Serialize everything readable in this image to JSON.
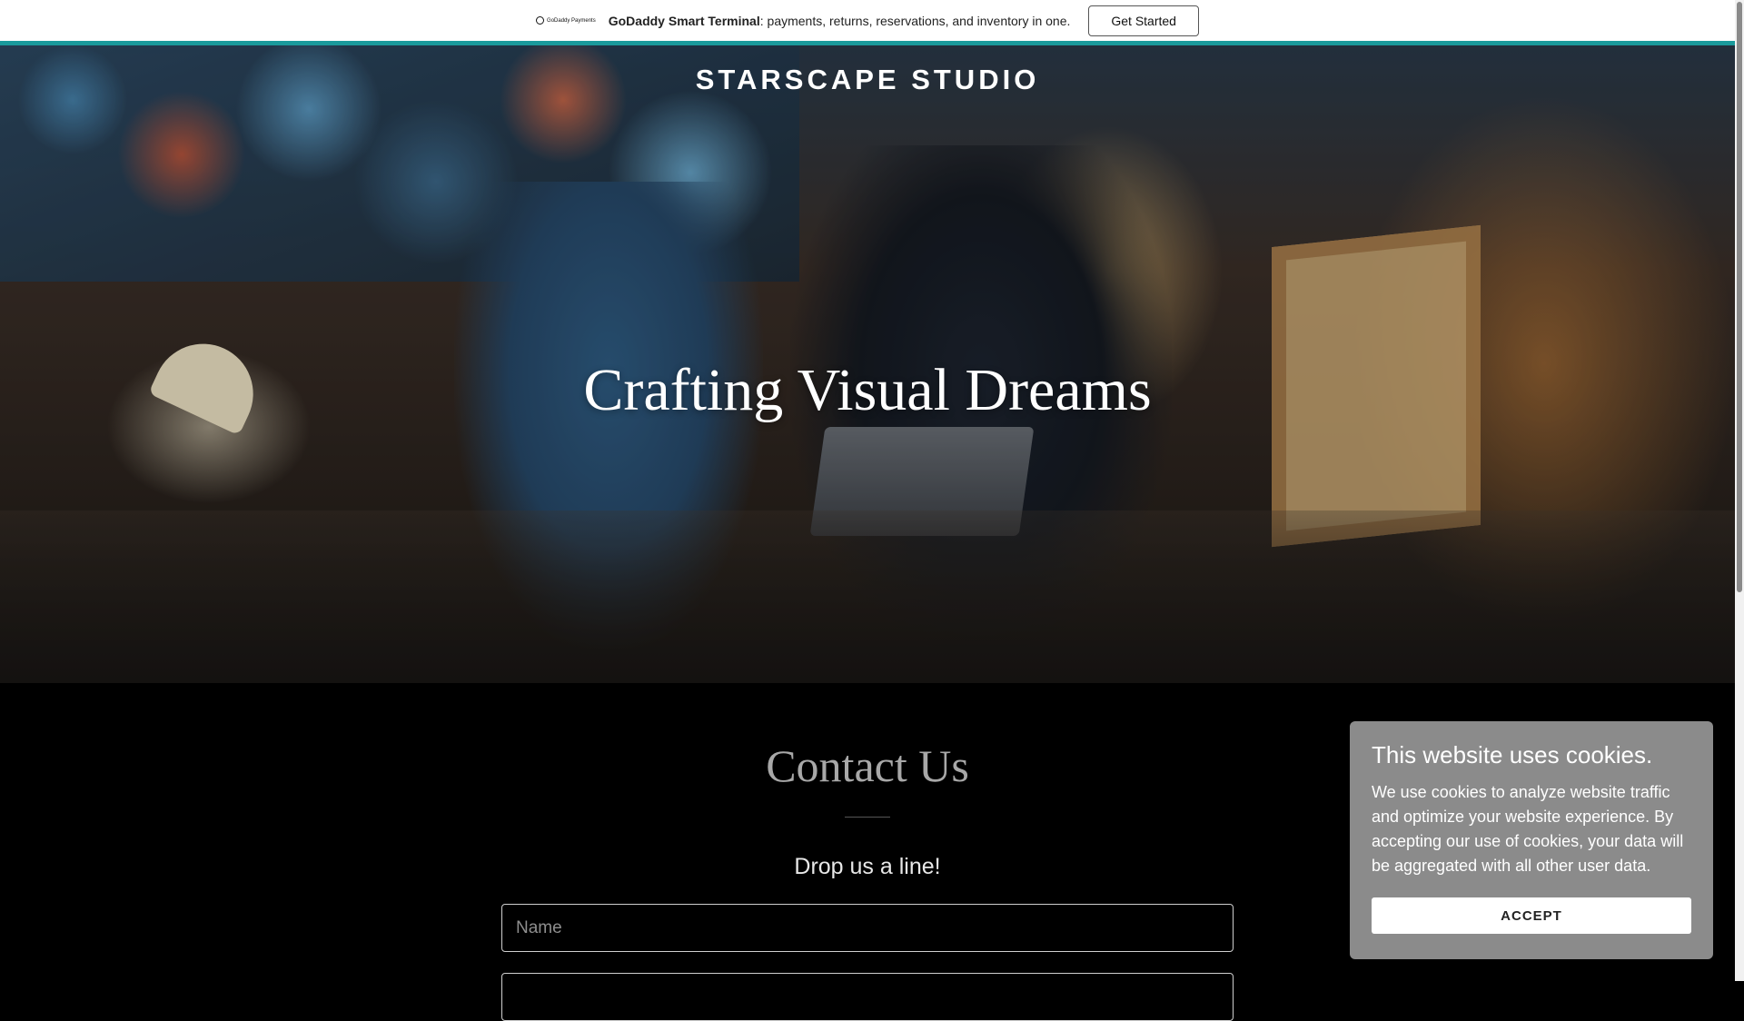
{
  "promo": {
    "logo_text": "GoDaddy Payments",
    "headline_bold": "GoDaddy Smart Terminal",
    "headline_rest": ": payments, returns, reservations, and inventory in one.",
    "cta_label": "Get Started",
    "accent_color": "#1a9a9c"
  },
  "hero": {
    "site_title": "STARSCAPE STUDIO",
    "headline": "Crafting Visual Dreams"
  },
  "contact": {
    "title": "Contact Us",
    "subtitle": "Drop us a line!",
    "name_placeholder": "Name",
    "email_placeholder": ""
  },
  "cookie_banner": {
    "title": "This website uses cookies.",
    "body": "We use cookies to analyze website traffic and optimize your website experience. By accepting our use of cookies, your data will be aggregated with all other user data.",
    "accept_label": "ACCEPT"
  }
}
